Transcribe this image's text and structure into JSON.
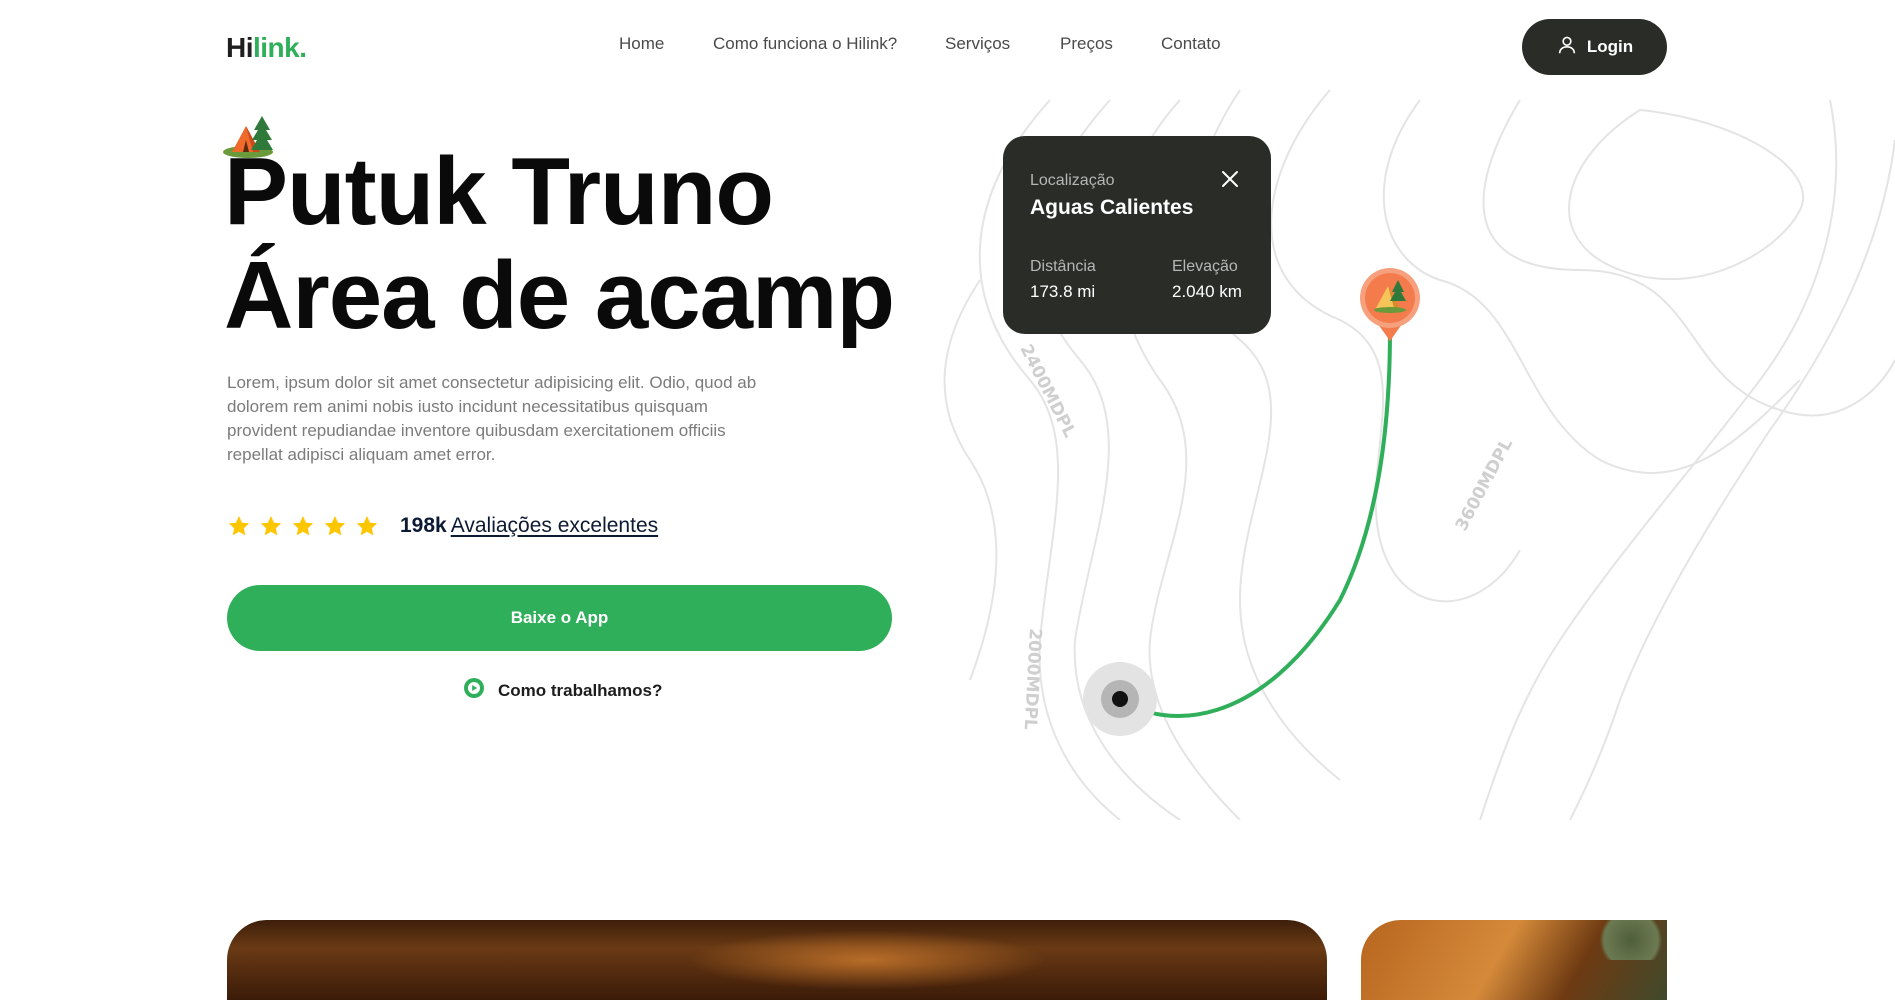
{
  "brand": {
    "logo_dark": "Hi",
    "logo_green": "link."
  },
  "nav": {
    "items": [
      "Home",
      "Como funciona o Hilink?",
      "Serviços",
      "Preços",
      "Contato"
    ],
    "login_label": "Login"
  },
  "hero": {
    "title_line1": "Putuk Truno",
    "title_line2": "Área de acamp",
    "description": "Lorem, ipsum dolor sit amet consectetur adipisicing elit. Odio, quod ab dolorem rem animi nobis iusto incidunt necessitatibus quisquam provident repudiandae inventore quibusdam exercitationem officiis repellat adipisci aliquam amet error.",
    "rating_stars": 5,
    "rating_count": "198k",
    "rating_label": "Avaliações excelentes",
    "cta_label": "Baixe o App",
    "how_label": "Como trabalhamos?"
  },
  "map": {
    "contour_labels": [
      "2400MDPL",
      "3600MDPL",
      "2000MDPL"
    ],
    "route_color": "#30af5b",
    "pin_color": "#f47c4c"
  },
  "location_card": {
    "location_label": "Localização",
    "location_name": "Aguas Calientes",
    "distance_label": "Distância",
    "distance_value": "173.8 mi",
    "elevation_label": "Elevação",
    "elevation_value": "2.040 km"
  },
  "colors": {
    "accent": "#30af5b",
    "dark": "#292c27",
    "star": "#fec601"
  }
}
